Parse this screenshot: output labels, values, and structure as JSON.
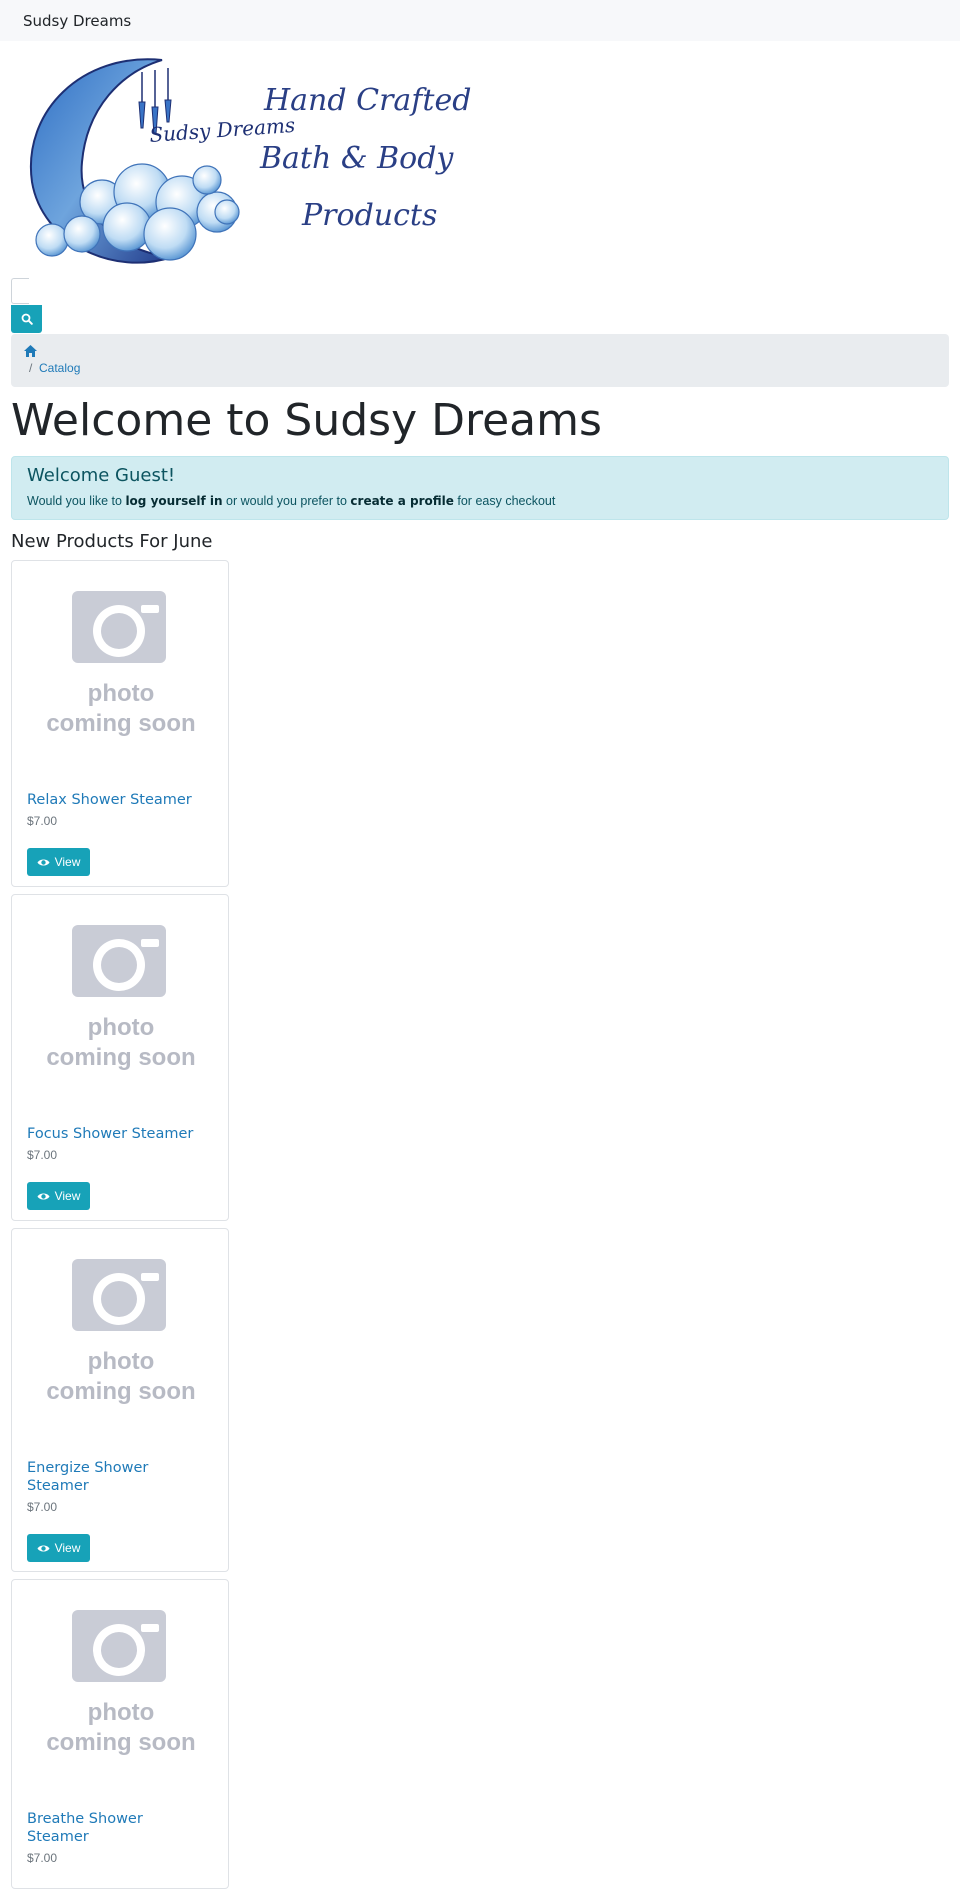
{
  "navbar": {
    "brand": "Sudsy Dreams"
  },
  "logo": {
    "icon": "crescent-moon-bubbles-logo",
    "moon_text": "Sudsy Dreams",
    "tagline": [
      "Hand Crafted",
      "Bath & Body",
      "Products"
    ]
  },
  "search": {
    "input_value": "",
    "button_icon": "search-icon"
  },
  "breadcrumb": {
    "home_icon": "home-icon",
    "separator": "/",
    "items": [
      "Catalog"
    ]
  },
  "page": {
    "title": "Welcome to Sudsy Dreams"
  },
  "alert": {
    "heading": "Welcome Guest!",
    "text_1": "Would you like to ",
    "link_login": "log yourself in",
    "text_2": " or would you prefer to ",
    "link_profile": "create a profile",
    "text_3": " for easy checkout"
  },
  "products_section": {
    "title": "New Products For June",
    "placeholder_image": {
      "line_1": "photo",
      "line_2": "coming soon"
    },
    "view_label": "View",
    "view_icon": "eye-icon",
    "items": [
      {
        "name": "Relax Shower Steamer",
        "price": "$7.00"
      },
      {
        "name": "Focus Shower Steamer",
        "price": "$7.00"
      },
      {
        "name": "Energize Shower Steamer",
        "price": "$7.00"
      },
      {
        "name": "Breathe Shower Steamer",
        "price": "$7.00"
      }
    ]
  },
  "colors": {
    "accent": "#17a2b8",
    "link": "#1f7ab8",
    "alert_bg": "#d1ecf1",
    "breadcrumb_bg": "#e9ecef"
  }
}
